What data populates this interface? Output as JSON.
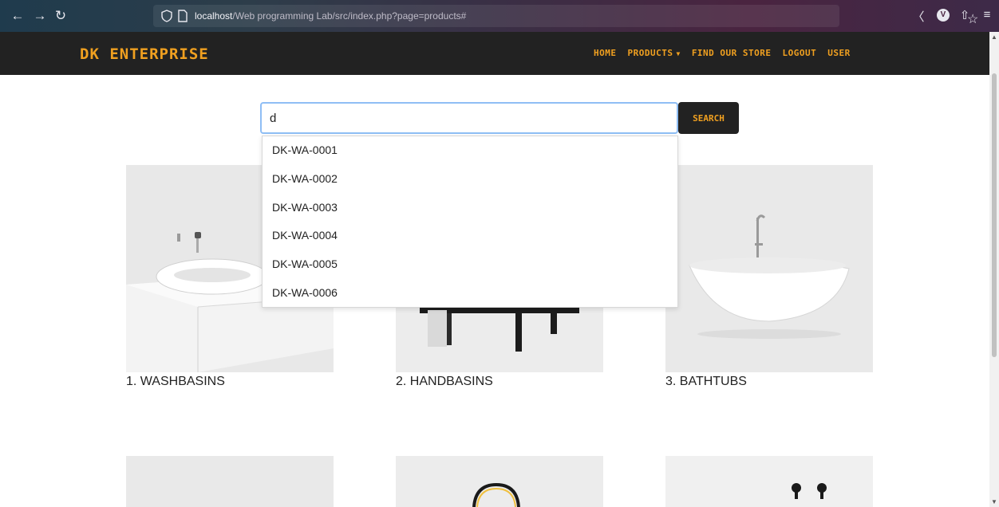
{
  "browser": {
    "url_host": "localhost",
    "url_path": "/Web programming Lab/src/index.php?page=products#",
    "avatar_letter": "V"
  },
  "site": {
    "brand": "DK ENTERPRISE",
    "nav": [
      {
        "label": "HOME"
      },
      {
        "label": "PRODUCTS"
      },
      {
        "label": "FIND OUR STORE"
      },
      {
        "label": "LOGOUT"
      },
      {
        "label": "USER"
      }
    ]
  },
  "search": {
    "value": "d",
    "button_label": "SEARCH",
    "suggestions": [
      "DK-WA-0001",
      "DK-WA-0002",
      "DK-WA-0003",
      "DK-WA-0004",
      "DK-WA-0005",
      "DK-WA-0006"
    ]
  },
  "products": [
    {
      "title": "1. WASHBASINS"
    },
    {
      "title": "2. HANDBASINS"
    },
    {
      "title": "3. BATHTUBS"
    }
  ],
  "colors": {
    "accent": "#f0a020",
    "nav_bg": "#222222",
    "input_focus": "#8fbef5"
  }
}
